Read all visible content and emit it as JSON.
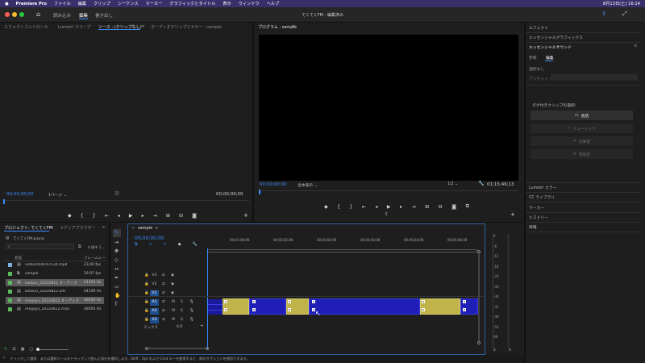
{
  "menubar": {
    "app": "Premiere Pro",
    "items": [
      "ファイル",
      "編集",
      "クリップ",
      "シーケンス",
      "マーカー",
      "グラフィックとタイトル",
      "表示",
      "ウィンドウ",
      "ヘルプ"
    ],
    "datetime": "8月13日(土) 16:14"
  },
  "titlebar": {
    "title": "てくてくFM - 編集済み",
    "tabs": [
      "読み込み",
      "編集",
      "書き出し"
    ]
  },
  "source_panel": {
    "tabs": [
      "エフェクトコントロール",
      "Lumetri スコープ",
      "ソース : (クリップなし)",
      "オーディオクリップミキサー : sample"
    ],
    "timecode_left": "00;00;00;00",
    "page_select": "1ページ",
    "timecode_right": "00;00;00;00"
  },
  "program_panel": {
    "tab": "プログラム : sample",
    "timecode_left": "00;00;00;00",
    "fit_select": "全体表示",
    "quality_select": "1/2",
    "timecode_right": "01;15;46;13"
  },
  "right_panel": {
    "items": [
      "エフェクト",
      "エッセンシャルグラフィックス",
      "エッセンシャルサウンド"
    ],
    "subtabs": [
      "参照",
      "編集"
    ],
    "no_selection": "選択なし",
    "preset_label": "プリセット :",
    "clip_type_prompt": "タグ付きクリップの選択:",
    "buttons": [
      "会話",
      "ミュージック",
      "効果音",
      "環境音"
    ],
    "bottom_items": [
      "Lumetri カラー",
      "CC ライブラリ",
      "マーカー",
      "ヒストリー",
      "情報"
    ]
  },
  "project_panel": {
    "tabs": [
      "プロジェクト: てくてくFM",
      "メディアブラウザー"
    ],
    "project_file": "てくてくFM.prproj",
    "item_count": "4 個中 1...",
    "columns": [
      "名前",
      "フレームレー"
    ],
    "rows": [
      {
        "name": "video1009797124.mp4",
        "rate": "23,00 fps",
        "color": "#7ab3e0",
        "selected": false
      },
      {
        "name": "sample",
        "rate": "29.97 fps",
        "color": "#5cb85c",
        "selected": false
      },
      {
        "name": "kokkun_20220812 オーディオ",
        "rate": "44100 Hz",
        "color": "#5cb85c",
        "selected": true
      },
      {
        "name": "kokkun_20220812.aifc",
        "rate": "44100 Hz",
        "color": "#5cb85c",
        "selected": false
      },
      {
        "name": "megayu_20220812 オーディオ",
        "rate": "48000 Hz",
        "color": "#5cb85c",
        "selected": true
      },
      {
        "name": "megayu_20220812.m4a",
        "rate": "48000 Hz",
        "color": "#5cb85c",
        "selected": false
      }
    ]
  },
  "timeline": {
    "tab": "sample",
    "timecode": "00;00;00;00",
    "ruler": [
      "00;01;48;06",
      "00;03;02;06",
      "00;03;04;06",
      "00;04;02;06",
      "00;05;04;06",
      "00;05;06;06"
    ],
    "video_tracks": [
      "V3",
      "V2",
      "V1"
    ],
    "audio_tracks": [
      "A1",
      "A2",
      "A3"
    ],
    "mix_label": "ミックス",
    "mix_value": "0.0"
  },
  "meters": {
    "labels": [
      "0",
      "-6",
      "-12",
      "-18",
      "-24",
      "-30",
      "-36",
      "-42",
      "-48",
      "-54",
      "dB"
    ],
    "solo": [
      "S",
      "S"
    ]
  },
  "status_bar": {
    "text": "クリックして選択、または選択ツールをドラッグして囲んだ部分を選択します。Shift、Opt および Cmd キーを使用すると、他のオプションを使用できます。"
  },
  "colors": {
    "accent": "#3b8cff",
    "clip_yellow": "#bfb34a",
    "clip_blue": "#1f1fb8",
    "menubar": "#3a2f6b"
  }
}
